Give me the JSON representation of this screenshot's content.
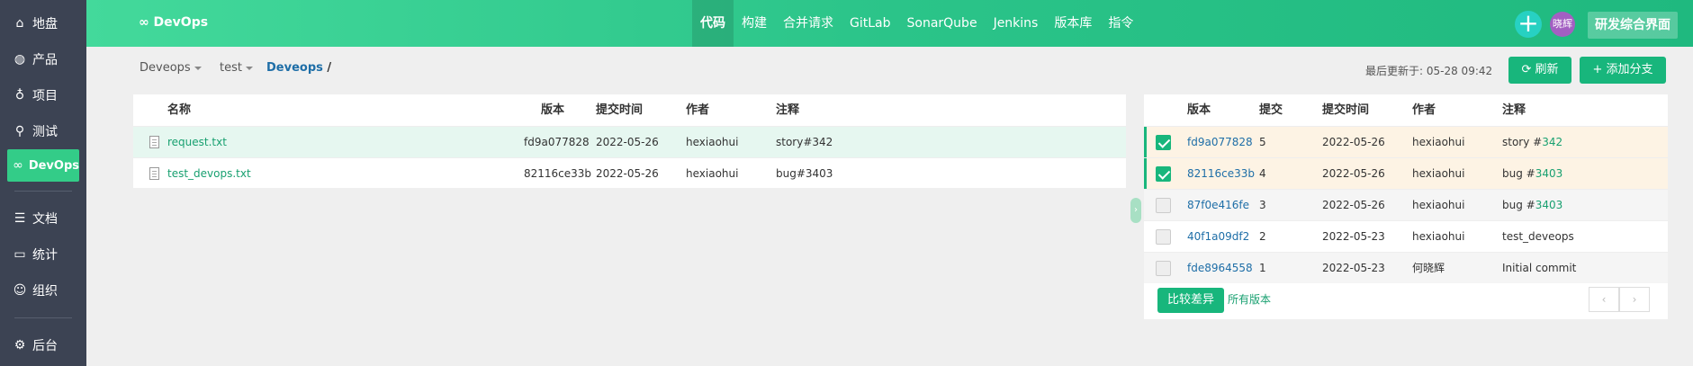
{
  "sidebar": {
    "items": [
      {
        "icon": "home-icon",
        "label": "地盘"
      },
      {
        "icon": "lightbulb-icon",
        "label": "产品"
      },
      {
        "icon": "bell-icon",
        "label": "项目"
      },
      {
        "icon": "search-icon",
        "label": "测试"
      },
      {
        "icon": "infinity-icon",
        "label": "DevOps"
      },
      {
        "icon": "document-icon",
        "label": "文档"
      },
      {
        "icon": "chart-icon",
        "label": "统计"
      },
      {
        "icon": "users-icon",
        "label": "组织"
      },
      {
        "icon": "gear-icon",
        "label": "后台"
      }
    ]
  },
  "header": {
    "brand": "DevOps",
    "nav": [
      "代码",
      "构建",
      "合并请求",
      "GitLab",
      "SonarQube",
      "Jenkins",
      "版本库",
      "指令"
    ],
    "active_nav": "代码",
    "avatar_text": "晓辉",
    "workbench_button": "研发综合界面",
    "colors": {
      "start": "#43d99b",
      "end": "#1fb97f"
    }
  },
  "toolbar": {
    "repo_select": "Deveops",
    "branch_select": "test",
    "path": "Deveops",
    "path_sep": "/",
    "last_updated_label": "最后更新于:",
    "last_updated_value": "05-28 09:42",
    "refresh_label": "刷新",
    "add_branch_label": "添加分支"
  },
  "files": {
    "headers": {
      "name": "名称",
      "revision": "版本",
      "date": "提交时间",
      "author": "作者",
      "comment": "注释"
    },
    "rows": [
      {
        "name": "request.txt",
        "revision": "fd9a077828",
        "date": "2022-05-26",
        "author": "hexiaohui",
        "comment": "story#342"
      },
      {
        "name": "test_devops.txt",
        "revision": "82116ce33b",
        "date": "2022-05-26",
        "author": "hexiaohui",
        "comment": "bug#3403"
      }
    ]
  },
  "commits": {
    "headers": {
      "revision": "版本",
      "commit": "提交",
      "date": "提交时间",
      "author": "作者",
      "comment": "注释"
    },
    "rows": [
      {
        "checked": true,
        "revision": "fd9a077828",
        "commit": "5",
        "date": "2022-05-26",
        "author": "hexiaohui",
        "comment_prefix": "story #",
        "comment_link": "342"
      },
      {
        "checked": true,
        "revision": "82116ce33b",
        "commit": "4",
        "date": "2022-05-26",
        "author": "hexiaohui",
        "comment_prefix": "bug #",
        "comment_link": "3403"
      },
      {
        "checked": false,
        "revision": "87f0e416fe",
        "commit": "3",
        "date": "2022-05-26",
        "author": "hexiaohui",
        "comment_prefix": "bug #",
        "comment_link": "3403"
      },
      {
        "checked": false,
        "revision": "40f1a09df2",
        "commit": "2",
        "date": "2022-05-23",
        "author": "hexiaohui",
        "comment_prefix": "test_deveops",
        "comment_link": ""
      },
      {
        "checked": false,
        "revision": "fde8964558",
        "commit": "1",
        "date": "2022-05-23",
        "author": "何晓辉",
        "comment_prefix": "Initial commit",
        "comment_link": ""
      }
    ],
    "compare_label": "比较差异",
    "all_versions_label": "所有版本",
    "prev_glyph": "‹",
    "next_glyph": "›"
  }
}
